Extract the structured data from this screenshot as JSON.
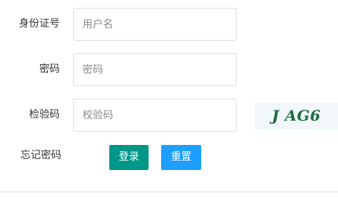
{
  "form": {
    "id_label": "身份证号",
    "id_placeholder": "用户名",
    "password_label": "密码",
    "password_placeholder": "密码",
    "captcha_label": "检验码",
    "captcha_placeholder": "校验码",
    "captcha_text": "J AG6",
    "forgot_label": "忘记密码",
    "login_label": "登录",
    "reset_label": "重置"
  },
  "colors": {
    "login_button": "#009688",
    "reset_button": "#1E9FFF",
    "captcha_text": "#1a6b3a"
  }
}
